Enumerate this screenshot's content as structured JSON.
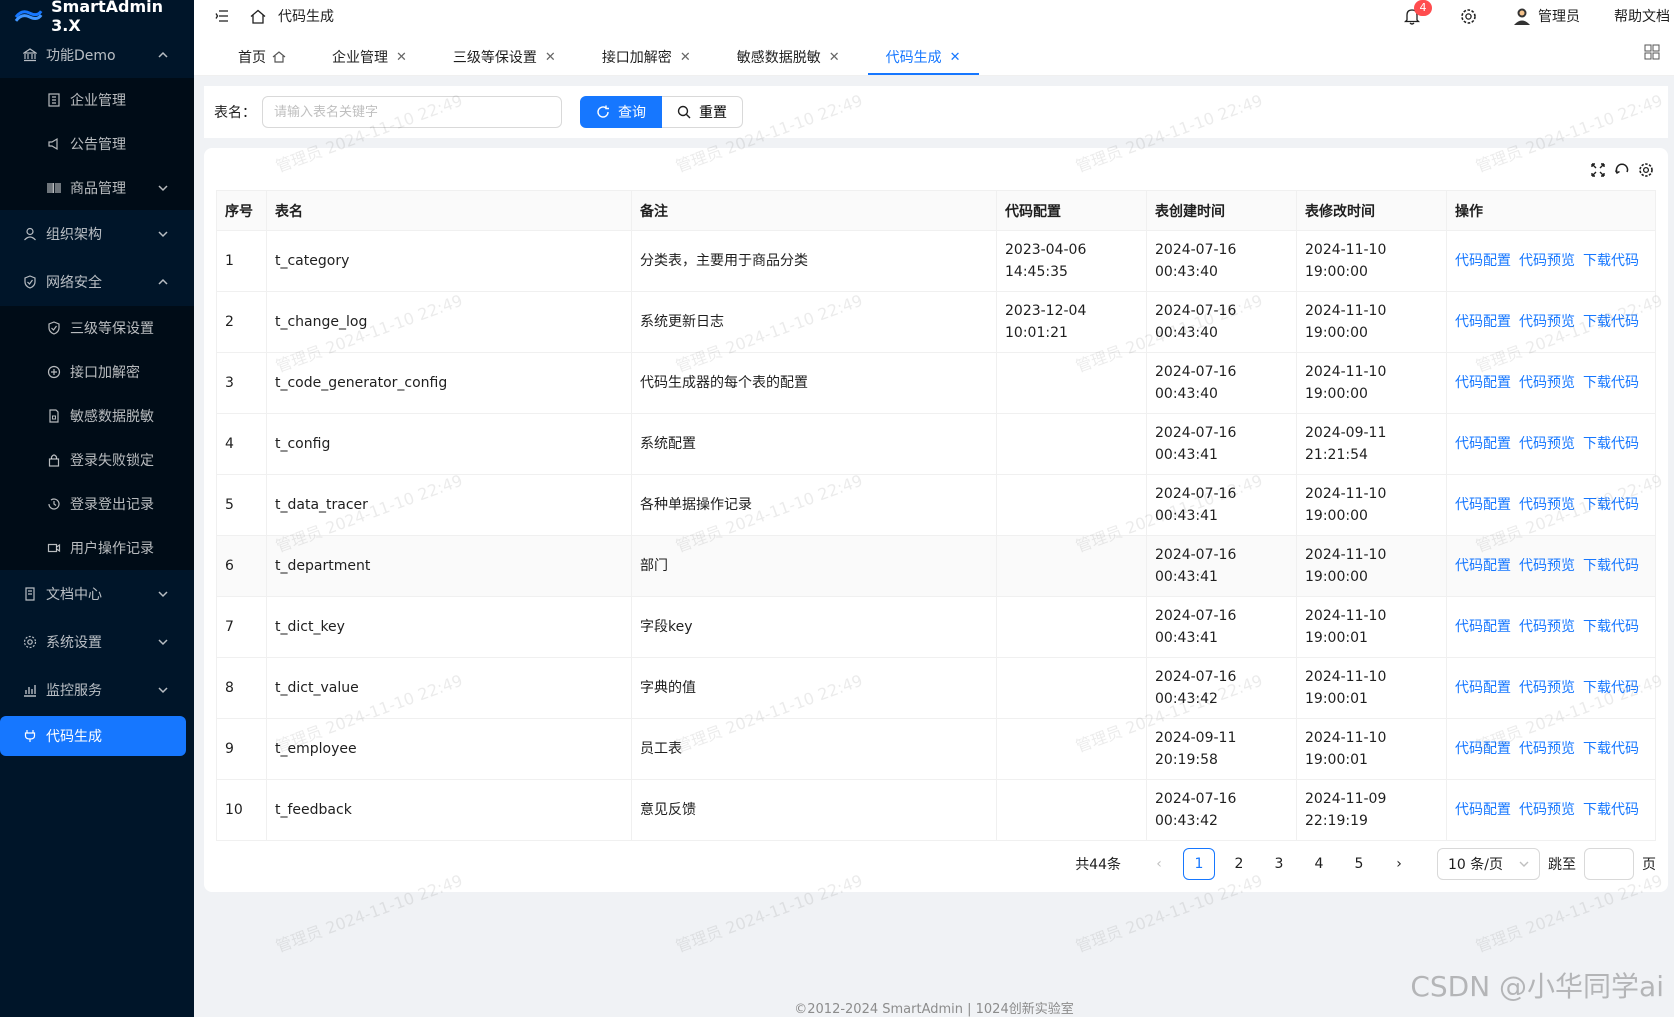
{
  "app": {
    "title": "SmartAdmin 3.X"
  },
  "sidebar": {
    "groups": [
      {
        "label": "功能Demo",
        "icon": "bank-icon",
        "expanded": true,
        "items": [
          {
            "label": "企业管理",
            "icon": "building-icon"
          },
          {
            "label": "公告管理",
            "icon": "speaker-icon"
          },
          {
            "label": "商品管理",
            "icon": "barcode-icon",
            "has_children": true
          }
        ]
      },
      {
        "label": "组织架构",
        "icon": "user-icon",
        "expanded": false
      },
      {
        "label": "网络安全",
        "icon": "shield-icon",
        "expanded": true,
        "items": [
          {
            "label": "三级等保设置",
            "icon": "shield-check-icon"
          },
          {
            "label": "接口加解密",
            "icon": "api-icon"
          },
          {
            "label": "敏感数据脱敏",
            "icon": "file-lock-icon"
          },
          {
            "label": "登录失败锁定",
            "icon": "lock-icon"
          },
          {
            "label": "登录登出记录",
            "icon": "history-icon"
          },
          {
            "label": "用户操作记录",
            "icon": "video-icon"
          }
        ]
      },
      {
        "label": "文档中心",
        "icon": "doc-icon",
        "expanded": false
      },
      {
        "label": "系统设置",
        "icon": "gear-icon",
        "expanded": false
      },
      {
        "label": "监控服务",
        "icon": "chart-icon",
        "expanded": false
      },
      {
        "label": "代码生成",
        "icon": "plug-icon",
        "active": true
      }
    ]
  },
  "header": {
    "breadcrumb": "代码生成",
    "notify_count": "4",
    "user_name": "管理员",
    "help_label": "帮助文档"
  },
  "tabs": [
    {
      "label": "首页",
      "closable": false,
      "home": true
    },
    {
      "label": "企业管理",
      "closable": true
    },
    {
      "label": "三级等保设置",
      "closable": true
    },
    {
      "label": "接口加解密",
      "closable": true
    },
    {
      "label": "敏感数据脱敏",
      "closable": true
    },
    {
      "label": "代码生成",
      "closable": true,
      "active": true
    }
  ],
  "search": {
    "label": "表名：",
    "placeholder": "请输入表名关键字",
    "query_label": "查询",
    "reset_label": "重置"
  },
  "table": {
    "columns": [
      "序号",
      "表名",
      "备注",
      "代码配置",
      "表创建时间",
      "表修改时间",
      "操作"
    ],
    "actions": [
      "代码配置",
      "代码预览",
      "下载代码"
    ],
    "rows": [
      {
        "idx": "1",
        "name": "t_category",
        "remark": "分类表，主要用于商品分类",
        "cfg_date": "2023-04-06",
        "cfg_time": "14:45:35",
        "ct_date": "2024-07-16",
        "ct_time": "00:43:40",
        "mt_date": "2024-11-10",
        "mt_time": "19:00:00"
      },
      {
        "idx": "2",
        "name": "t_change_log",
        "remark": "系统更新日志",
        "cfg_date": "2023-12-04",
        "cfg_time": "10:01:21",
        "ct_date": "2024-07-16",
        "ct_time": "00:43:40",
        "mt_date": "2024-11-10",
        "mt_time": "19:00:00"
      },
      {
        "idx": "3",
        "name": "t_code_generator_config",
        "remark": "代码生成器的每个表的配置",
        "cfg_date": "",
        "cfg_time": "",
        "ct_date": "2024-07-16",
        "ct_time": "00:43:40",
        "mt_date": "2024-11-10",
        "mt_time": "19:00:00"
      },
      {
        "idx": "4",
        "name": "t_config",
        "remark": "系统配置",
        "cfg_date": "",
        "cfg_time": "",
        "ct_date": "2024-07-16",
        "ct_time": "00:43:41",
        "mt_date": "2024-09-11",
        "mt_time": "21:21:54"
      },
      {
        "idx": "5",
        "name": "t_data_tracer",
        "remark": "各种单据操作记录",
        "cfg_date": "",
        "cfg_time": "",
        "ct_date": "2024-07-16",
        "ct_time": "00:43:41",
        "mt_date": "2024-11-10",
        "mt_time": "19:00:00"
      },
      {
        "idx": "6",
        "name": "t_department",
        "remark": "部门",
        "cfg_date": "",
        "cfg_time": "",
        "ct_date": "2024-07-16",
        "ct_time": "00:43:41",
        "mt_date": "2024-11-10",
        "mt_time": "19:00:00"
      },
      {
        "idx": "7",
        "name": "t_dict_key",
        "remark": "字段key",
        "cfg_date": "",
        "cfg_time": "",
        "ct_date": "2024-07-16",
        "ct_time": "00:43:41",
        "mt_date": "2024-11-10",
        "mt_time": "19:00:01"
      },
      {
        "idx": "8",
        "name": "t_dict_value",
        "remark": "字典的值",
        "cfg_date": "",
        "cfg_time": "",
        "ct_date": "2024-07-16",
        "ct_time": "00:43:42",
        "mt_date": "2024-11-10",
        "mt_time": "19:00:01"
      },
      {
        "idx": "9",
        "name": "t_employee",
        "remark": "员工表",
        "cfg_date": "",
        "cfg_time": "",
        "ct_date": "2024-09-11",
        "ct_time": "20:19:58",
        "mt_date": "2024-11-10",
        "mt_time": "19:00:01"
      },
      {
        "idx": "10",
        "name": "t_feedback",
        "remark": "意见反馈",
        "cfg_date": "",
        "cfg_time": "",
        "ct_date": "2024-07-16",
        "ct_time": "00:43:42",
        "mt_date": "2024-11-09",
        "mt_time": "22:19:19"
      }
    ]
  },
  "pagination": {
    "total_label": "共44条",
    "pages": [
      "1",
      "2",
      "3",
      "4",
      "5"
    ],
    "current": "1",
    "page_size_label": "10 条/页",
    "jump_label": "跳至",
    "page_suffix": "页"
  },
  "footer": {
    "copyright": "©2012-2024 SmartAdmin | 1024创新实验室"
  },
  "watermark": {
    "text": "管理员 2024-11-10 22:49",
    "corner_text": "CSDN @小华同学ai"
  },
  "colors": {
    "primary": "#1677ff",
    "sidebar_bg": "#001529",
    "submenu_bg": "#000c17",
    "badge": "#ff4d4f"
  }
}
